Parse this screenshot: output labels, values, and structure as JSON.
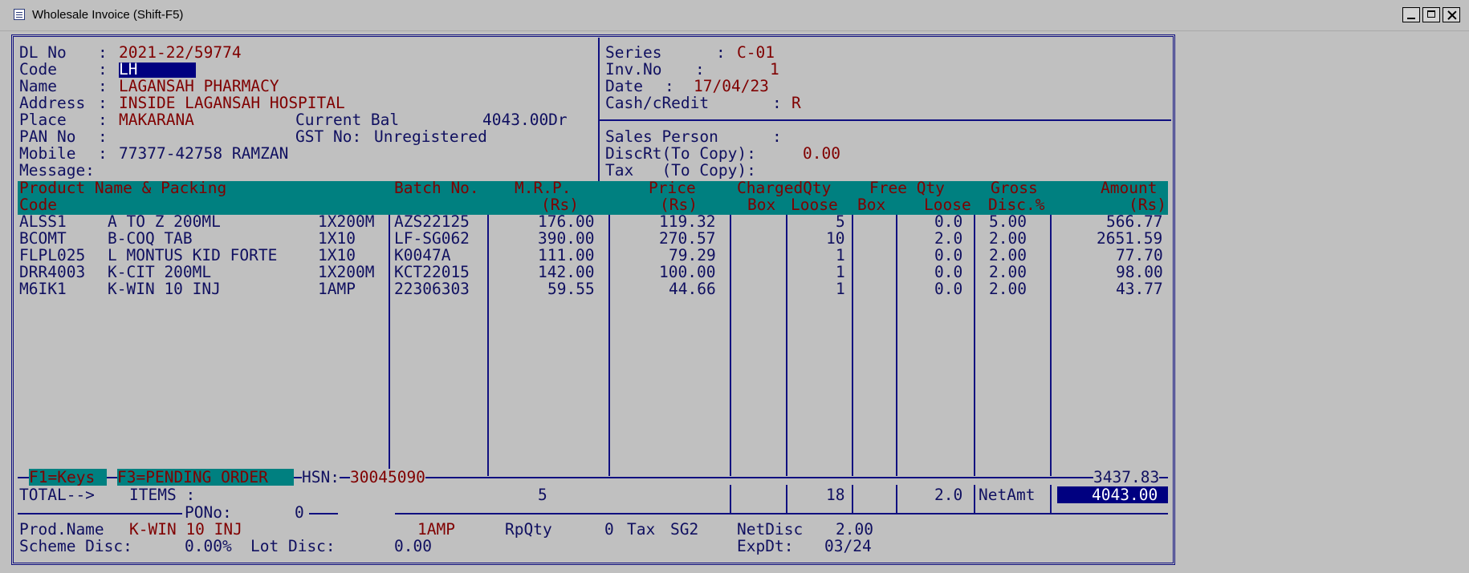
{
  "window": {
    "title": "Wholesale Invoice (Shift-F5)"
  },
  "header": {
    "dl_label": "DL No",
    "dl_no": "2021-22/59774",
    "code_label": "Code",
    "code": "LH",
    "name_label": "Name",
    "name": "LAGANSAH PHARMACY",
    "address_label": "Address",
    "address": "INSIDE LAGANSAH HOSPITAL",
    "place_label": "Place",
    "place": "MAKARANA",
    "current_bal_label": "Current Bal",
    "current_bal": "4043.00Dr",
    "pan_label": "PAN No",
    "pan": "",
    "gst_label": "GST No:",
    "gst": "Unregistered",
    "mobile_label": "Mobile",
    "mobile": "77377-42758 RAMZAN",
    "message_label": "Message:",
    "series_label": "Series",
    "series": "C-01",
    "inv_no_label": "Inv.No",
    "inv_no": "1",
    "date_label": "Date",
    "date": "17/04/23",
    "cash_credit_label": "Cash/cRedit",
    "cash_credit": "R",
    "sales_person_label": "Sales Person",
    "sales_person": "",
    "disc_rt_label": "DiscRt(To Copy):",
    "disc_rt": "0.00",
    "tax_label": "Tax   (To Copy):",
    "tax": ""
  },
  "table": {
    "headers": {
      "product": "Product Name & Packing",
      "code": "Code",
      "batch": "Batch No.",
      "mrp": "M.R.P.",
      "mrp_unit": "(Rs)",
      "price": "Price",
      "price_unit": "(Rs)",
      "charged_qty": "ChargedQty",
      "box": "Box",
      "loose": "Loose",
      "free_qty": "Free Qty",
      "free_box": "Box",
      "free_loose": "Loose",
      "gross": "Gross",
      "disc": "Disc.%",
      "amount": "Amount",
      "amount_unit": "(Rs)"
    },
    "rows": [
      {
        "code": "ALSS1",
        "name": "A TO Z 200ML",
        "pack": "1X200M",
        "batch": "AZS22125",
        "mrp": "176.00",
        "price": "119.32",
        "box": "",
        "loose": "5",
        "free_box": "",
        "free_loose": "0.0",
        "disc": "5.00",
        "amount": "566.77"
      },
      {
        "code": "BCOMT",
        "name": "B-COQ TAB",
        "pack": "1X10",
        "batch": "LF-SG062",
        "mrp": "390.00",
        "price": "270.57",
        "box": "",
        "loose": "10",
        "free_box": "",
        "free_loose": "2.0",
        "disc": "2.00",
        "amount": "2651.59"
      },
      {
        "code": "FLPL025",
        "name": "L MONTUS KID FORTE",
        "pack": "1X10",
        "batch": "K0047A",
        "mrp": "111.00",
        "price": "79.29",
        "box": "",
        "loose": "1",
        "free_box": "",
        "free_loose": "0.0",
        "disc": "2.00",
        "amount": "77.70"
      },
      {
        "code": "DRR4003",
        "name": "K-CIT 200ML",
        "pack": "1X200M",
        "batch": "KCT22015",
        "mrp": "142.00",
        "price": "100.00",
        "box": "",
        "loose": "1",
        "free_box": "",
        "free_loose": "0.0",
        "disc": "2.00",
        "amount": "98.00"
      },
      {
        "code": "M6IK1",
        "name": "K-WIN 10 INJ",
        "pack": "1AMP",
        "batch": "22306303",
        "mrp": "59.55",
        "price": "44.66",
        "box": "",
        "loose": "1",
        "free_box": "",
        "free_loose": "0.0",
        "disc": "2.00",
        "amount": "43.77"
      }
    ]
  },
  "footer": {
    "f1": "F1=Keys",
    "f3": "F3=PENDING ORDER",
    "hsn_label": "HSN:",
    "hsn": "30045090",
    "gross_total": "3437.83",
    "total_label": "TOTAL-->",
    "items_label": "ITEMS :",
    "items": "5",
    "loose_total": "18",
    "free_total": "2.0",
    "netamt_label": "NetAmt",
    "netamt": "4043.00",
    "pono_label": "PONo:",
    "pono": "0",
    "prod_name_label": "Prod.Name",
    "prod_name": "K-WIN 10 INJ",
    "prod_pack": "1AMP",
    "rpqty_label": "RpQty",
    "rpqty": "0",
    "tax_label": "Tax",
    "tax": "SG2",
    "net_disc_label": "NetDisc",
    "net_disc": "2.00",
    "scheme_disc_label": "Scheme Disc:",
    "scheme_disc": "0.00%",
    "lot_disc_label": "Lot Disc:",
    "lot_disc": "0.00",
    "exp_dt_label": "ExpDt:",
    "exp_dt": "03/24"
  }
}
